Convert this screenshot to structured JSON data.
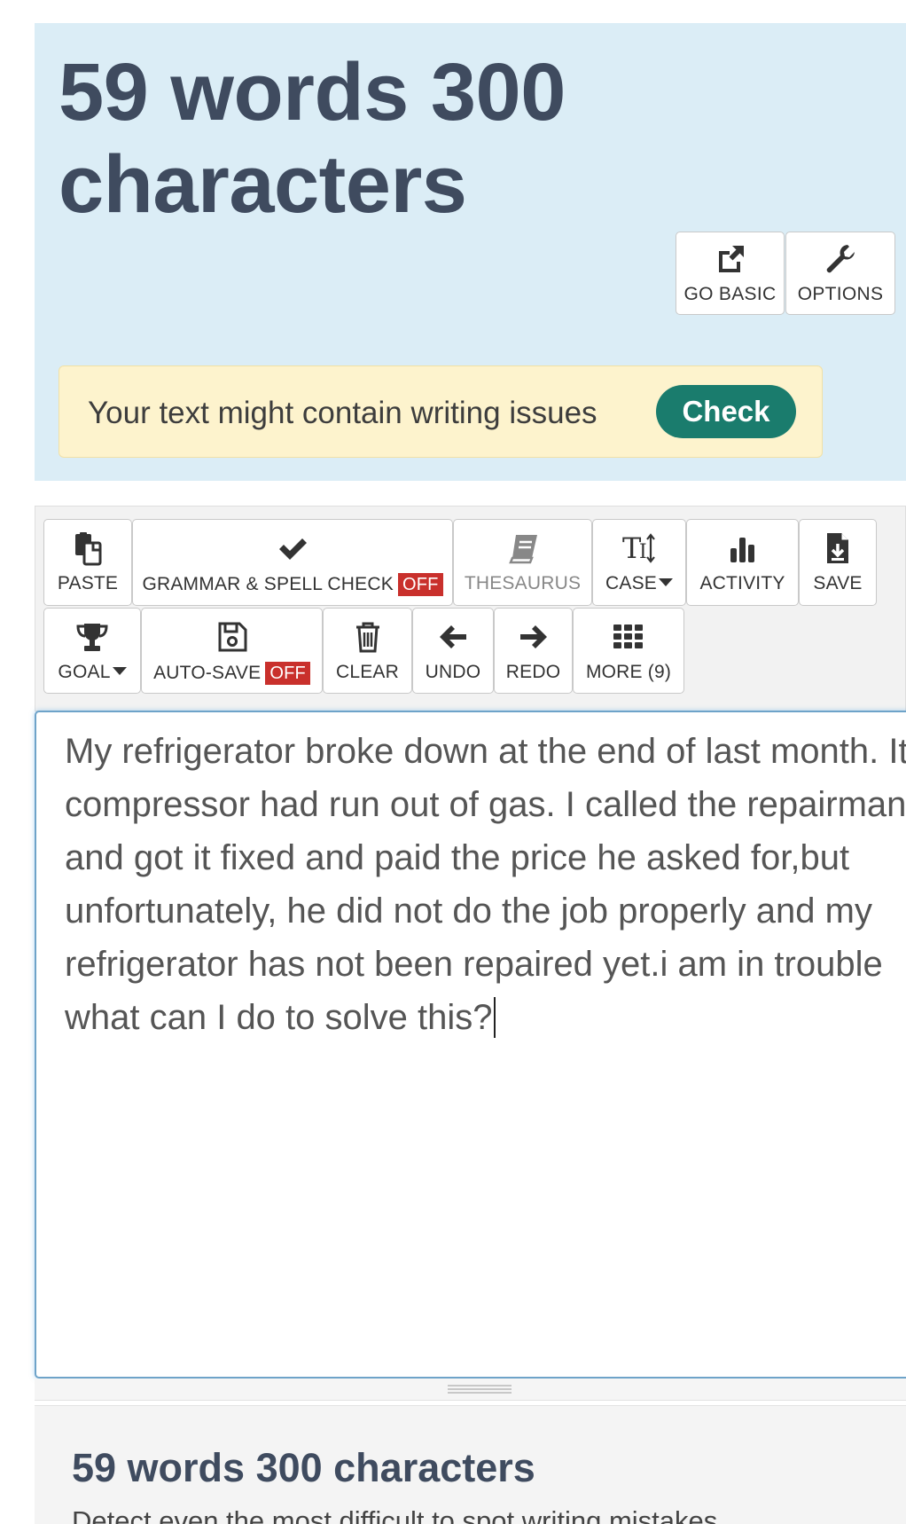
{
  "header": {
    "count_title": "59 words 300 characters",
    "go_basic_label": "GO BASIC",
    "options_label": "OPTIONS"
  },
  "issues": {
    "message": "Your text might contain writing issues",
    "check_label": "Check"
  },
  "toolbar": {
    "paste": "PASTE",
    "grammar": "GRAMMAR & SPELL CHECK",
    "grammar_state": "OFF",
    "thesaurus": "THESAURUS",
    "case": "CASE",
    "activity": "ACTIVITY",
    "save": "SAVE",
    "goal": "GOAL",
    "autosave": "AUTO-SAVE",
    "autosave_state": "OFF",
    "clear": "CLEAR",
    "undo": "UNDO",
    "redo": "REDO",
    "more": "MORE (9)"
  },
  "editor": {
    "text": "My refrigerator broke down at the end of last month. Its compressor had run out of gas. I called the repairman and got it fixed and paid the price he asked for,but unfortunately, he did not do the job properly and my refrigerator has not been repaired yet.i am in trouble what can I do to solve this?"
  },
  "summary": {
    "title": "59 words 300 characters",
    "subtitle": "Detect even the most difficult to spot writing mistakes"
  },
  "colors": {
    "header_bg": "#dbedf6",
    "title_color": "#3f4b5f",
    "check_button": "#1a7c6d",
    "off_badge": "#c9302c",
    "issues_bg": "#fdf3cd"
  }
}
